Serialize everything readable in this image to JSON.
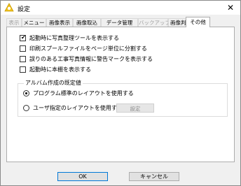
{
  "window": {
    "title": "設定",
    "close_glyph": "✕"
  },
  "tabs": [
    {
      "label": "表示",
      "state": "disabled"
    },
    {
      "label": "メニュー",
      "state": "normal"
    },
    {
      "label": "画像表示",
      "state": "normal"
    },
    {
      "label": "画像取込",
      "state": "normal"
    },
    {
      "label": "データ管理",
      "state": "normal"
    },
    {
      "label": "バックアップ",
      "state": "disabled"
    },
    {
      "label": "画像判定",
      "state": "normal"
    },
    {
      "label": "その他",
      "state": "active"
    }
  ],
  "options": [
    {
      "label": "起動時に写真整理ツールを表示する",
      "checked": true
    },
    {
      "label": "印刷スプールファイルをページ単位に分割する",
      "checked": false
    },
    {
      "label": "誤りのある工事写真情報に警告マークを表示する",
      "checked": false
    },
    {
      "label": "起動時に本棚を表示する",
      "checked": false
    }
  ],
  "album_group": {
    "title": "アルバム作成の既定値",
    "radios": [
      {
        "label": "プログラム標準のレイアウトを使用する",
        "selected": true
      },
      {
        "label": "ユーザ指定のレイアウトを使用する",
        "selected": false
      }
    ],
    "setting_button": "設定"
  },
  "buttons": {
    "ok": "OK",
    "cancel": "キャンセル"
  }
}
